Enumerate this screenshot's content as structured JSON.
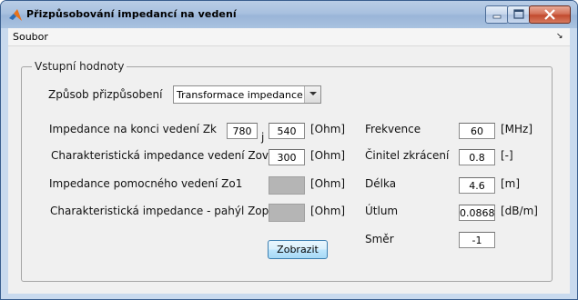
{
  "window": {
    "title": "Přizpůsobování impedancí na vedení"
  },
  "menu": {
    "file": "Soubor",
    "overflow_glyph": "↘"
  },
  "panel": {
    "title": "Vstupní hodnoty",
    "method_label": "Způsob přizpůsobení",
    "method_value": "Transformace impedance",
    "left": {
      "zk_label": "Impedance na konci vedení Zk",
      "zk_real": "780",
      "j_symbol": "j",
      "zk_imag": "540",
      "zk_unit": "[Ohm]",
      "zov_label": "Charakteristická impedance vedení Zov",
      "zov_value": "300",
      "zov_unit": "[Ohm]",
      "zo1_label": "Impedance pomocného vedení Zo1",
      "zo1_unit": "[Ohm]",
      "zop_label": "Charakteristická impedance - pahýl Zop",
      "zop_unit": "[Ohm]"
    },
    "right": {
      "freq_label": "Frekvence",
      "freq_value": "60",
      "freq_unit": "[MHz]",
      "shortening_label": "Činitel zkrácení",
      "shortening_value": "0.8",
      "shortening_unit": "[-]",
      "length_label": "Délka",
      "length_value": "4.6",
      "length_unit": "[m]",
      "attenuation_label": "Útlum",
      "attenuation_value": "0.0868",
      "attenuation_unit": "[dB/m]",
      "direction_label": "Směr",
      "direction_value": "-1"
    },
    "show_button": "Zobrazit"
  }
}
